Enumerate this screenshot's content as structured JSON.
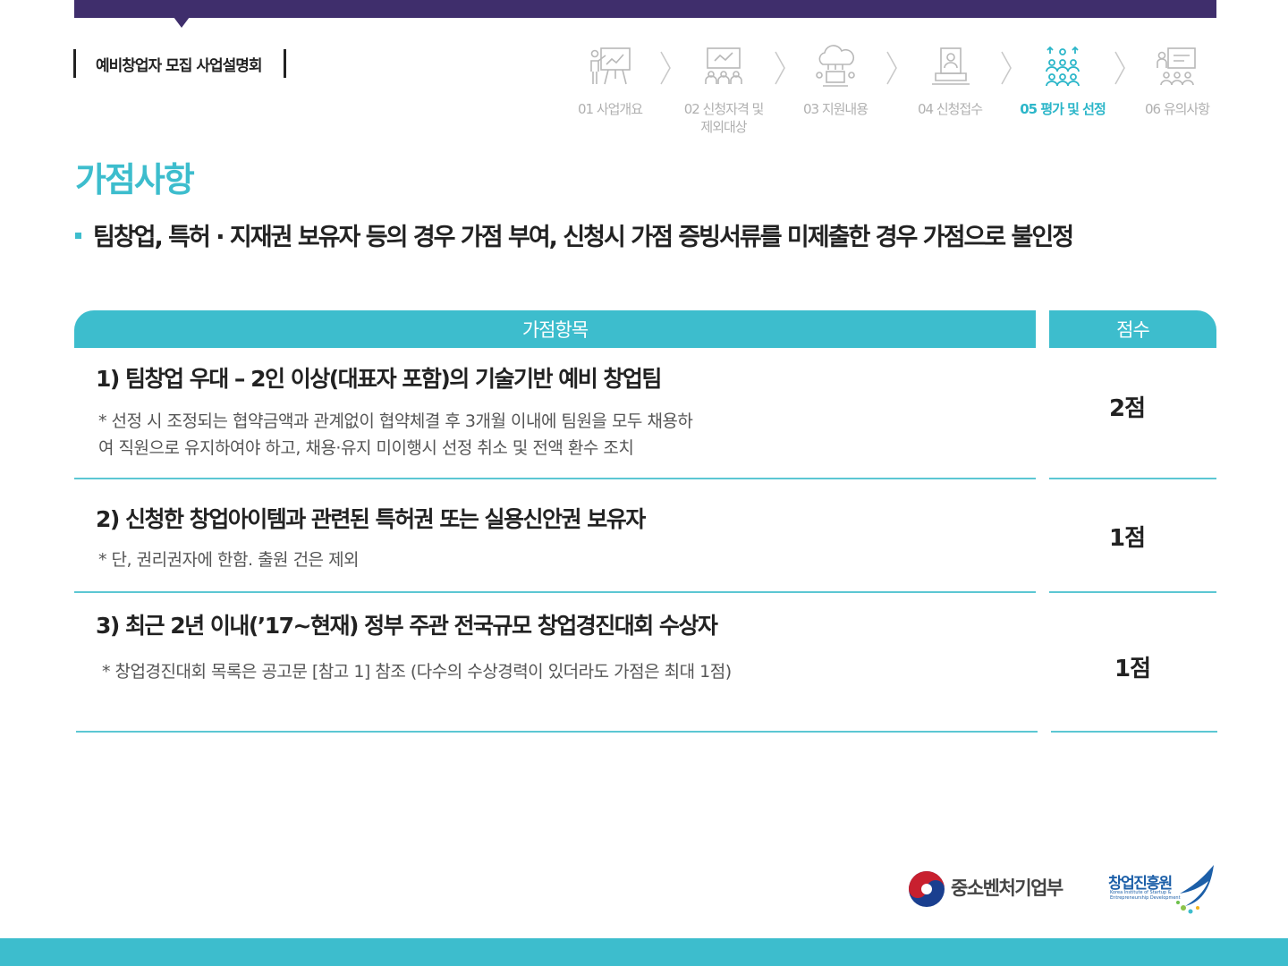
{
  "header": {
    "brand": "예비창업자 모집 사업설명회"
  },
  "steps": [
    {
      "label": "01 사업개요",
      "icon": "presentation-icon",
      "active": false
    },
    {
      "label": "02 신청자격 및 제외대상",
      "label_line1": "02 신청자격 및",
      "label_line2": "제외대상",
      "icon": "meeting-board-icon",
      "active": false
    },
    {
      "label": "03 지원내용",
      "icon": "cloud-computer-icon",
      "active": false
    },
    {
      "label": "04 신청접수",
      "icon": "laptop-document-icon",
      "active": false
    },
    {
      "label": "05 평가 및 선정",
      "icon": "team-evaluation-icon",
      "active": true
    },
    {
      "label": "06 유의사항",
      "icon": "notice-board-icon",
      "active": false
    }
  ],
  "section_title": "가점사항",
  "bullet": "팀창업, 특허 · 지재권 보유자 등의 경우 가점 부여, 신청시 가점 증빙서류를 미제출한 경우 가점으로 불인정",
  "table": {
    "headers": {
      "item": "가점항목",
      "score": "점수"
    },
    "rows": [
      {
        "title": "1) 팀창업 우대 – 2인 이상(대표자 포함)의 기술기반 예비 창업팀",
        "note_line1": "* 선정 시 조정되는 협약금액과 관계없이 협약체결 후 3개월 이내에 팀원을 모두 채용하",
        "note_line2": "여 직원으로 유지하여야 하고, 채용·유지 미이행시 선정 취소 및 전액 환수 조치",
        "score": "2점"
      },
      {
        "title": "2) 신청한 창업아이템과 관련된 특허권 또는 실용신안권 보유자",
        "note_line1": "* 단, 권리권자에 한함. 출원 건은 제외",
        "score": "1점"
      },
      {
        "title": "3) 최근 2년 이내(’17~현재) 정부 주관 전국규모 창업경진대회 수상자",
        "note_line1": "* 창업경진대회 목록은 공고문 [참고 1] 참조 (다수의 수상경력이 있더라도 가점은 최대 1점)",
        "score": "1점"
      }
    ]
  },
  "footer_logos": {
    "ministry": "중소벤처기업부",
    "agency": "창업진흥원",
    "agency_sub": "Korea Institute of Startup & Entrepreneurship Development"
  },
  "colors": {
    "accent": "#3dbdcd",
    "header_bar": "#3f2e6c",
    "inactive_step": "#b0b0b0",
    "active_step": "#2cb6c9"
  }
}
